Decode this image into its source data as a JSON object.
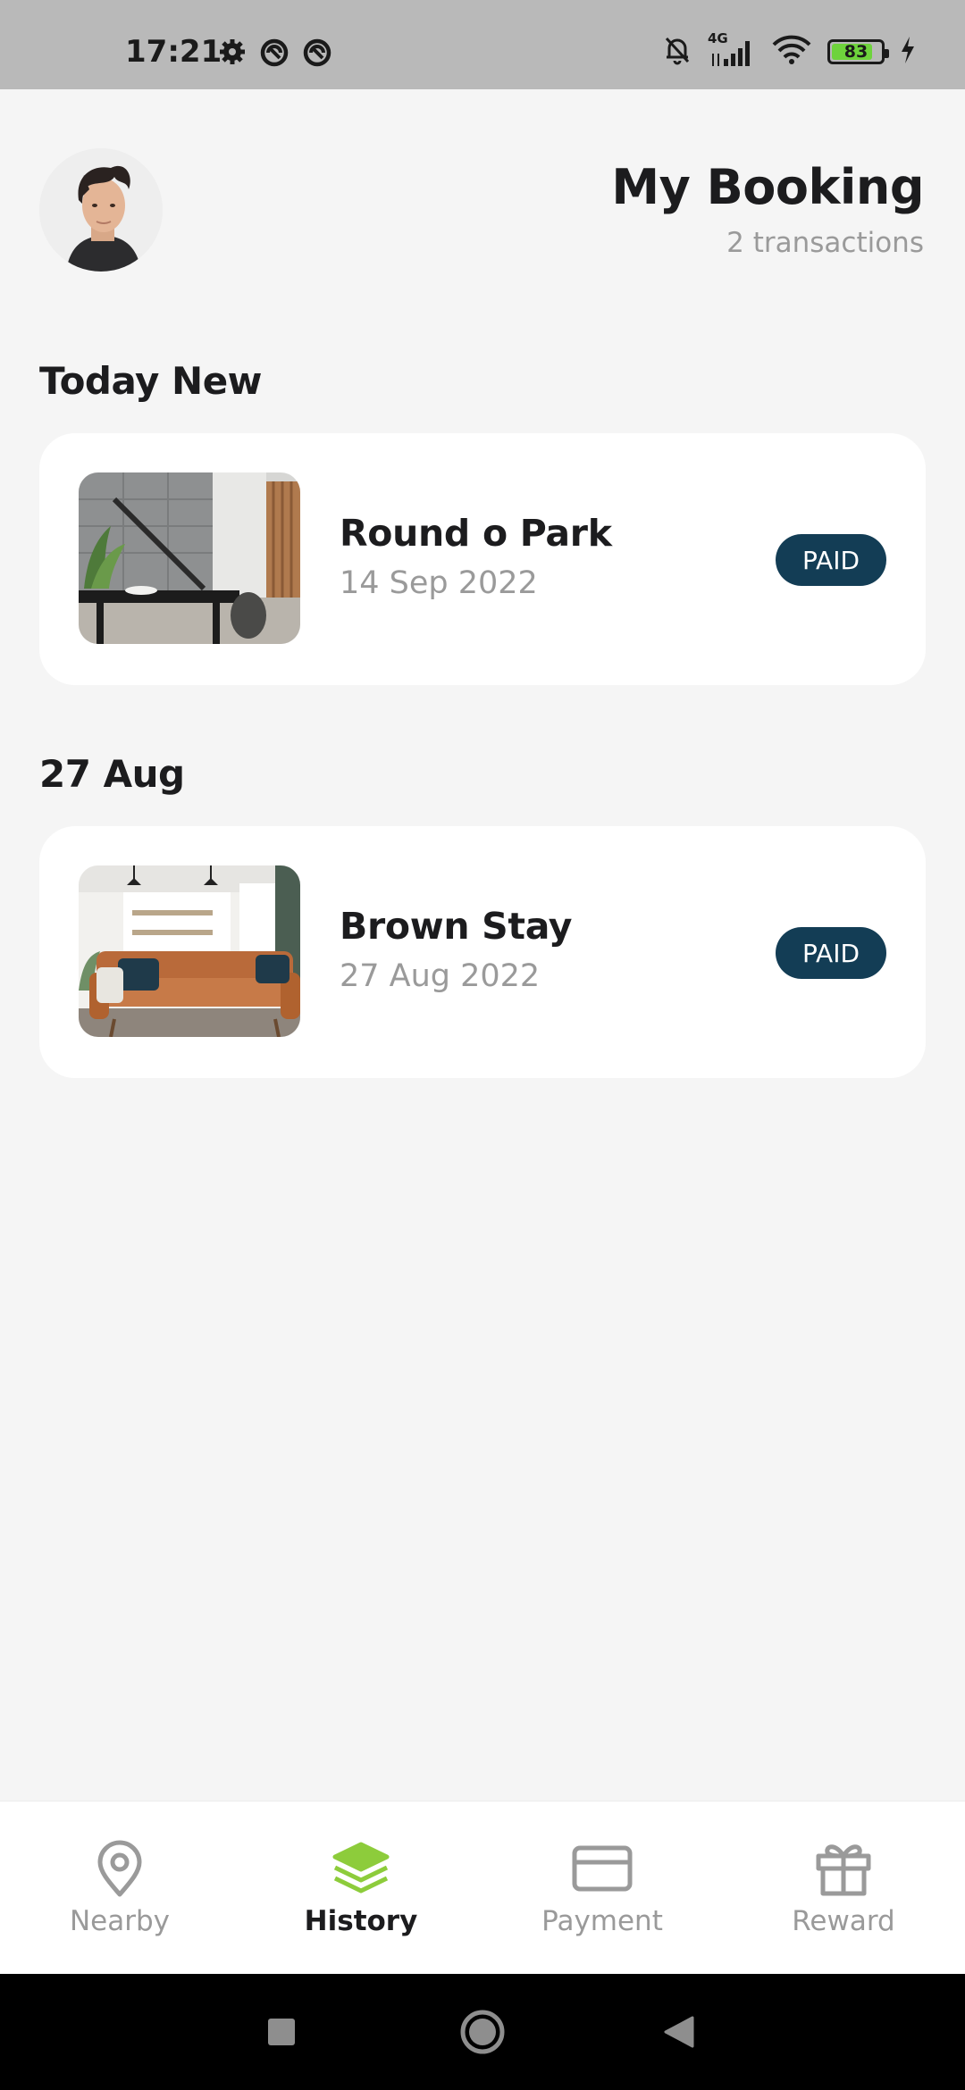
{
  "status_bar": {
    "time": "17:21",
    "network": "4G",
    "battery_level": "83",
    "battery_fraction": 0.83,
    "left_icons": [
      "gear-icon",
      "data-saver-icon",
      "data-saver-icon"
    ],
    "right_icons": [
      "bell-off-icon",
      "signal-icon",
      "wifi-icon",
      "battery-icon",
      "charging-icon"
    ]
  },
  "header": {
    "title": "My Booking",
    "subtitle": "2 transactions"
  },
  "sections": [
    {
      "title": "Today New",
      "bookings": [
        {
          "name": "Round o Park",
          "date": "14 Sep 2022",
          "status": "PAID"
        }
      ]
    },
    {
      "title": "27 Aug",
      "bookings": [
        {
          "name": "Brown Stay",
          "date": "27 Aug 2022",
          "status": "PAID"
        }
      ]
    }
  ],
  "bottom_nav": {
    "items": [
      {
        "label": "Nearby",
        "icon": "location-pin-icon",
        "active": false
      },
      {
        "label": "History",
        "icon": "layers-icon",
        "active": true
      },
      {
        "label": "Payment",
        "icon": "credit-card-icon",
        "active": false
      },
      {
        "label": "Reward",
        "icon": "gift-icon",
        "active": false
      }
    ]
  },
  "colors": {
    "accent": "#8dcc3b",
    "badge": "#133d55",
    "background": "#f5f5f5",
    "card": "#ffffff",
    "muted_text": "#9a9a9a"
  }
}
